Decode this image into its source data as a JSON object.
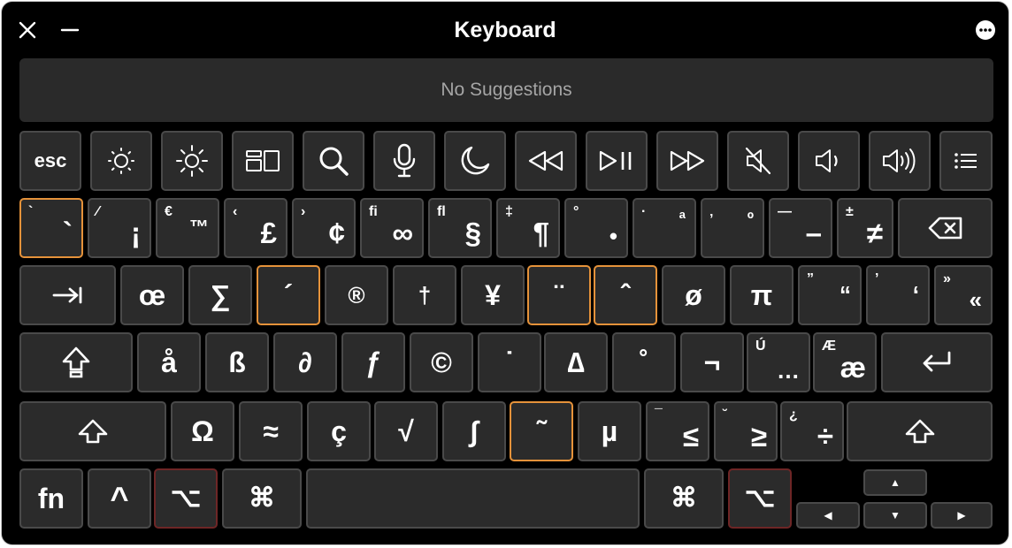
{
  "window": {
    "title": "Keyboard"
  },
  "suggestions": {
    "text": "No Suggestions"
  },
  "rows": {
    "fn_row": {
      "esc": "esc"
    },
    "num_row": [
      {
        "top": "`",
        "main": "`"
      },
      {
        "top": "⁄",
        "main": "¡"
      },
      {
        "top": "€",
        "main": "™"
      },
      {
        "top": "‹",
        "main": "£"
      },
      {
        "top": "›",
        "main": "¢"
      },
      {
        "top": "ﬁ",
        "main": "∞"
      },
      {
        "top": "ﬂ",
        "main": "§"
      },
      {
        "top": "‡",
        "main": "¶"
      },
      {
        "top": "°",
        "main": "•"
      },
      {
        "top": "·",
        "main": "ª"
      },
      {
        "top": "‚",
        "main": "º"
      },
      {
        "top": "—",
        "main": "–"
      },
      {
        "top": "±",
        "main": "≠"
      }
    ],
    "q_row": [
      "œ",
      "∑",
      "´",
      "®",
      "†",
      "¥",
      "¨",
      "ˆ",
      "ø",
      "π"
    ],
    "q_row_pairs": [
      {
        "top": "”",
        "main": "“"
      },
      {
        "top": "’",
        "main": "‘"
      },
      {
        "top": "»",
        "main": "«"
      }
    ],
    "a_row": [
      "å",
      "ß",
      "∂",
      "ƒ",
      "©",
      "˙",
      "∆",
      "˚",
      "¬"
    ],
    "a_row_pairs": [
      {
        "top": "Ú",
        "main": "…"
      },
      {
        "top": "Æ",
        "main": "æ"
      }
    ],
    "z_row": [
      "Ω",
      "≈",
      "ç",
      "√",
      "∫",
      "˜",
      "µ"
    ],
    "z_row_pairs": [
      {
        "top": "¯",
        "main": "≤"
      },
      {
        "top": "˘",
        "main": "≥"
      },
      {
        "top": "¿",
        "main": "÷"
      }
    ],
    "bottom_row": {
      "fn": "fn",
      "ctrl": "^",
      "opt": "⌥",
      "cmd": "⌘"
    }
  },
  "icons": [
    "close-icon",
    "minimize-icon",
    "more-icon",
    "brightness-down-icon",
    "brightness-up-icon",
    "mission-control-icon",
    "spotlight-icon",
    "dictation-icon",
    "do-not-disturb-icon",
    "rewind-icon",
    "play-pause-icon",
    "fast-forward-icon",
    "mute-icon",
    "volume-down-icon",
    "volume-up-icon",
    "menu-icon",
    "delete-icon",
    "tab-icon",
    "caps-lock-icon",
    "return-icon",
    "shift-icon",
    "arrow-up-icon",
    "arrow-down-icon",
    "arrow-left-icon",
    "arrow-right-icon"
  ],
  "colors": {
    "background": "#000000",
    "key": "#2b2b2b",
    "key_border": "#4a4a4a",
    "dead_key": "#e5923a",
    "active_modifier": "#6e2626"
  }
}
